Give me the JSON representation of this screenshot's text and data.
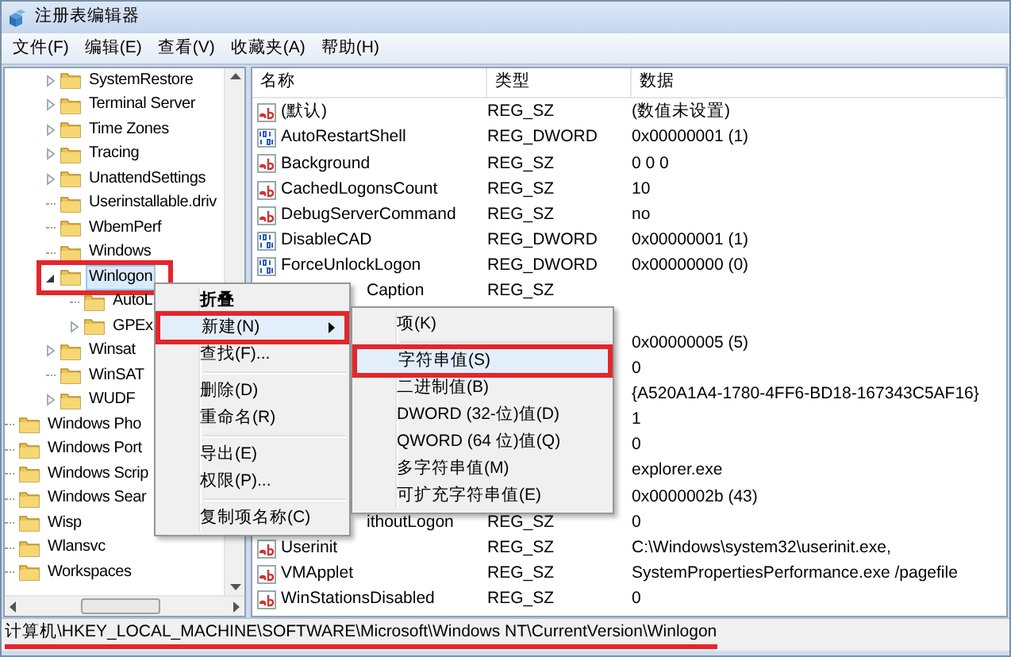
{
  "window": {
    "title": "注册表编辑器"
  },
  "menu_bar": [
    "文件(F)",
    "编辑(E)",
    "查看(V)",
    "收藏夹(A)",
    "帮助(H)"
  ],
  "tree": {
    "nested_items": [
      {
        "label": "SystemRestore",
        "kind": "collapsed",
        "selected": false,
        "annotated": false
      },
      {
        "label": "Terminal Server",
        "kind": "collapsed",
        "selected": false,
        "annotated": false
      },
      {
        "label": "Time Zones",
        "kind": "collapsed",
        "selected": false,
        "annotated": false
      },
      {
        "label": "Tracing",
        "kind": "collapsed",
        "selected": false,
        "annotated": false
      },
      {
        "label": "UnattendSettings",
        "kind": "collapsed",
        "selected": false,
        "annotated": false
      },
      {
        "label": "Userinstallable.driv",
        "kind": "leaf",
        "selected": false,
        "annotated": false
      },
      {
        "label": "WbemPerf",
        "kind": "leaf",
        "selected": false,
        "annotated": false
      },
      {
        "label": "Windows",
        "kind": "leaf",
        "selected": false,
        "annotated": false
      },
      {
        "label": "Winlogon",
        "kind": "expanded",
        "selected": true,
        "annotated": true,
        "children": [
          {
            "label": "AutoL",
            "kind": "leaf",
            "selected": false,
            "annotated": false
          },
          {
            "label": "GPEx",
            "kind": "collapsed",
            "selected": false,
            "annotated": false
          }
        ]
      },
      {
        "label": "Winsat",
        "kind": "collapsed",
        "selected": false,
        "annotated": false
      },
      {
        "label": "WinSAT",
        "kind": "leaf",
        "selected": false,
        "annotated": false
      },
      {
        "label": "WUDF",
        "kind": "collapsed",
        "selected": false,
        "annotated": false
      }
    ],
    "items": [
      {
        "label": "Windows Pho",
        "kind": "leaf",
        "selected": false,
        "annotated": false
      },
      {
        "label": "Windows Port",
        "kind": "leaf",
        "selected": false,
        "annotated": false
      },
      {
        "label": "Windows Scrip",
        "kind": "leaf",
        "selected": false,
        "annotated": false
      },
      {
        "label": "Windows Sear",
        "kind": "leaf",
        "selected": false,
        "annotated": false
      },
      {
        "label": "Wisp",
        "kind": "leaf",
        "selected": false,
        "annotated": false
      },
      {
        "label": "Wlansvc",
        "kind": "leaf",
        "selected": false,
        "annotated": false
      },
      {
        "label": "Workspaces",
        "kind": "leaf",
        "selected": false,
        "annotated": false
      }
    ]
  },
  "table": {
    "columns": [
      "名称",
      "类型",
      "数据"
    ],
    "rows": [
      {
        "kind": "string",
        "name": "(默认)",
        "type": "REG_SZ",
        "data": "(数值未设置)"
      },
      {
        "kind": "binary",
        "name": "AutoRestartShell",
        "type": "REG_DWORD",
        "data": "0x00000001 (1)"
      },
      {
        "kind": "string",
        "name": "Background",
        "type": "REG_SZ",
        "data": "0 0 0"
      },
      {
        "kind": "string",
        "name": "CachedLogonsCount",
        "type": "REG_SZ",
        "data": "10"
      },
      {
        "kind": "string",
        "name": "DebugServerCommand",
        "type": "REG_SZ",
        "data": "no"
      },
      {
        "kind": "binary",
        "name": "DisableCAD",
        "type": "REG_DWORD",
        "data": "0x00000001 (1)"
      },
      {
        "kind": "binary",
        "name": "ForceUnlockLogon",
        "type": "REG_DWORD",
        "data": "0x00000000 (0)"
      },
      {
        "kind": "cut",
        "name": "Caption",
        "type": "REG_SZ"
      },
      {
        "kind": "hidden"
      },
      {
        "kind": "hidden",
        "data": "0x00000005 (5)"
      },
      {
        "kind": "hidden",
        "data": "0"
      },
      {
        "kind": "hidden",
        "data": "{A520A1A4-1780-4FF6-BD18-167343C5AF16}"
      },
      {
        "kind": "hidden",
        "data": "1"
      },
      {
        "kind": "hidden",
        "data": "0"
      },
      {
        "kind": "hidden",
        "data": "explorer.exe"
      },
      {
        "kind": "hidden",
        "data": "0x0000002b (43)"
      },
      {
        "kind": "cut",
        "name": "ithoutLogon",
        "type": "REG_SZ",
        "data": "0"
      },
      {
        "kind": "string",
        "name": "Userinit",
        "type": "REG_SZ",
        "data": "C:\\Windows\\system32\\userinit.exe,"
      },
      {
        "kind": "string",
        "name": "VMApplet",
        "type": "REG_SZ",
        "data": "SystemPropertiesPerformance.exe /pagefile"
      },
      {
        "kind": "string",
        "name": "WinStationsDisabled",
        "type": "REG_SZ",
        "data": "0"
      }
    ]
  },
  "context_menu": {
    "items": [
      {
        "kind": "item",
        "label": "折叠",
        "default": true,
        "selected": false,
        "submenu": false,
        "annotated": false
      },
      {
        "kind": "item",
        "label": "新建(N)",
        "default": false,
        "selected": true,
        "submenu": true,
        "annotated": true
      },
      {
        "kind": "item",
        "label": "查找(F)...",
        "default": false,
        "selected": false,
        "submenu": false,
        "annotated": false
      },
      {
        "kind": "separator"
      },
      {
        "kind": "item",
        "label": "删除(D)",
        "default": false,
        "selected": false,
        "submenu": false,
        "annotated": false
      },
      {
        "kind": "item",
        "label": "重命名(R)",
        "default": false,
        "selected": false,
        "submenu": false,
        "annotated": false
      },
      {
        "kind": "separator"
      },
      {
        "kind": "item",
        "label": "导出(E)",
        "default": false,
        "selected": false,
        "submenu": false,
        "annotated": false
      },
      {
        "kind": "item",
        "label": "权限(P)...",
        "default": false,
        "selected": false,
        "submenu": false,
        "annotated": false
      },
      {
        "kind": "separator"
      },
      {
        "kind": "item",
        "label": "复制项名称(C)",
        "default": false,
        "selected": false,
        "submenu": false,
        "annotated": false
      }
    ]
  },
  "submenu": {
    "items": [
      {
        "kind": "item",
        "label": "项(K)",
        "default": false,
        "selected": false,
        "submenu": false,
        "annotated": false
      },
      {
        "kind": "separator"
      },
      {
        "kind": "item",
        "label": "字符串值(S)",
        "default": false,
        "selected": true,
        "submenu": false,
        "annotated": true
      },
      {
        "kind": "item",
        "label": "二进制值(B)",
        "default": false,
        "selected": false,
        "submenu": false,
        "annotated": false
      },
      {
        "kind": "item",
        "label": "DWORD (32-位)值(D)",
        "default": false,
        "selected": false,
        "submenu": false,
        "annotated": false
      },
      {
        "kind": "item",
        "label": "QWORD (64 位)值(Q)",
        "default": false,
        "selected": false,
        "submenu": false,
        "annotated": false
      },
      {
        "kind": "item",
        "label": "多字符串值(M)",
        "default": false,
        "selected": false,
        "submenu": false,
        "annotated": false
      },
      {
        "kind": "item",
        "label": "可扩充字符串值(E)",
        "default": false,
        "selected": false,
        "submenu": false,
        "annotated": false
      }
    ]
  },
  "status_bar": {
    "text": "计算机\\HKEY_LOCAL_MACHINE\\SOFTWARE\\Microsoft\\Windows NT\\CurrentVersion\\Winlogon",
    "underlined": true
  }
}
